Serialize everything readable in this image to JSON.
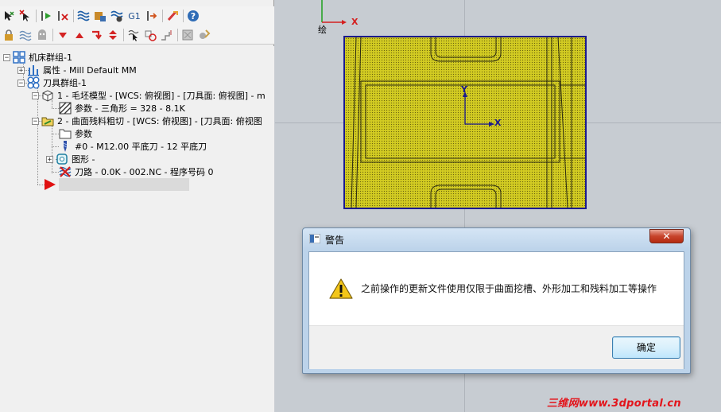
{
  "toolbar": {
    "row1": [
      "select-icon",
      "deselect-icon",
      "regenerate-icon",
      "dirty-regenerate-icon",
      "verify-toolpath-icon",
      "backplot-icon",
      "simulate-icon",
      "g1-icon",
      "post-icon",
      "highfeed-icon",
      "help-icon"
    ],
    "g1_label": "G1",
    "row2": [
      "lock-icon",
      "toggle-display-icon",
      "hide-icon",
      "move-down-icon",
      "move-up-icon",
      "insert-arrow-icon",
      "scroll-icon",
      "select-toolpath-icon",
      "select-tool-icon",
      "toolpath-editor-icon",
      "solid-icon",
      "settings-icon"
    ]
  },
  "tree": {
    "machine_group": "机床群组-1",
    "properties": "属性 - Mill Default MM",
    "toolpath_group": "刀具群组-1",
    "op1": "1 - 毛坯模型 - [WCS: 俯视图] - [刀具面: 俯视图] - m",
    "op1_params": "参数 - 三角形 =  328 - 8.1K",
    "op2": "2 - 曲面残料粗切 - [WCS: 俯视图] - [刀具面: 俯视图",
    "op2_params": "参数",
    "op2_tool": "#0 - M12.00 平底刀 - 12 平底刀",
    "op2_geometry": "图形 -",
    "op2_toolpath": "刀路 - 0.0K - 002.NC - 程序号码 0"
  },
  "viewport": {
    "top_axis_x": "X",
    "top_label": "绘",
    "part_axis_y": "Y",
    "part_axis_x": "X",
    "part_color": "#d2cb22",
    "outline_color": "#1b1a8e"
  },
  "dialog": {
    "title": "警告",
    "close_symbol": "✕",
    "message": "之前操作的更新文件使用仅限于曲面挖槽、外形加工和残料加工等操作",
    "ok_label": "确定",
    "warning_icon": "warning-icon"
  },
  "watermark": "三维网www.3dportal.cn"
}
